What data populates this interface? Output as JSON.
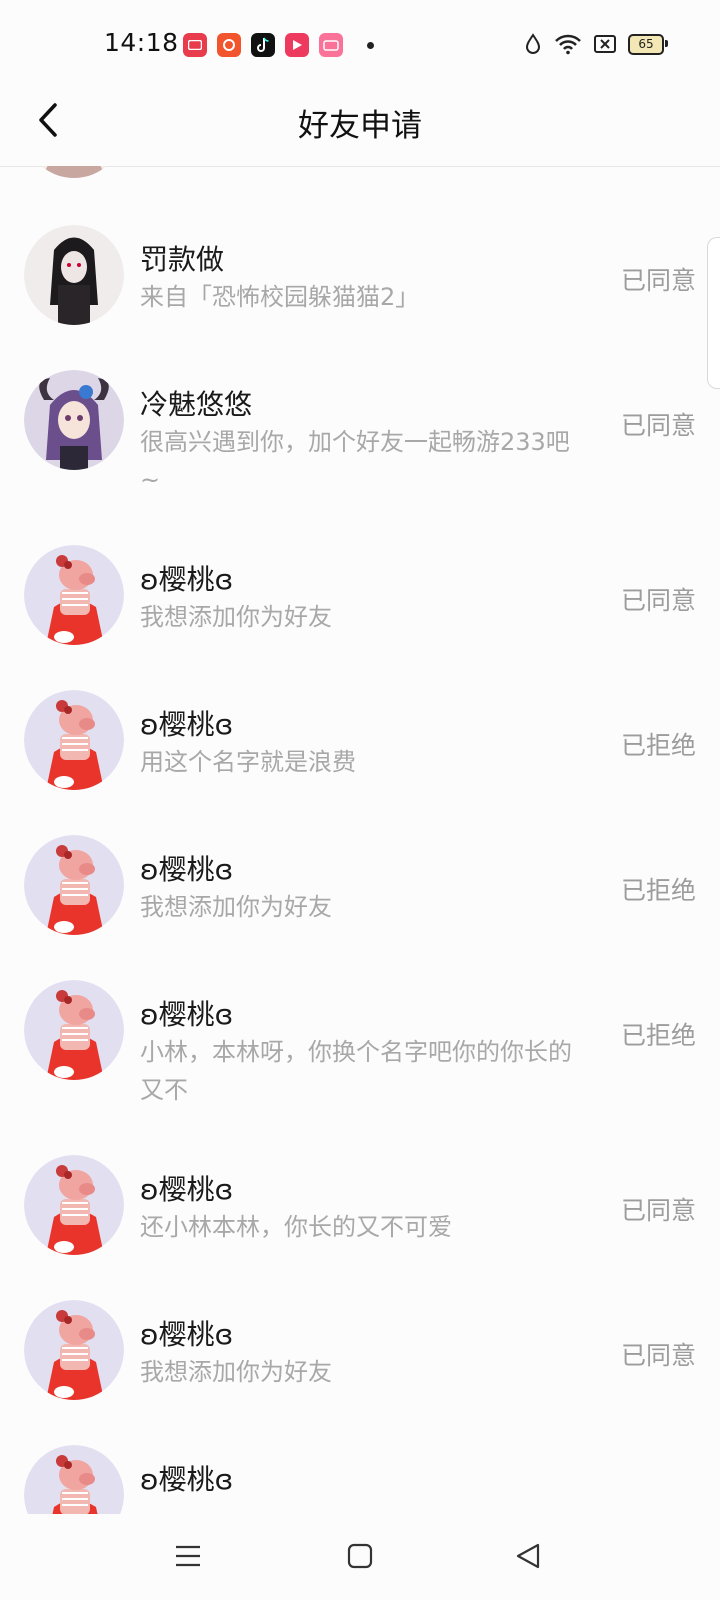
{
  "status_bar": {
    "time": "14:18",
    "battery": "65"
  },
  "header": {
    "title": "好友申请"
  },
  "requests": [
    {
      "name": "罚款做",
      "message": "来自「恐怖校园躲猫猫2」",
      "status": "已同意"
    },
    {
      "name": "冷魅悠悠",
      "message": "很高兴遇到你，加个好友一起畅游233吧~",
      "status": "已同意"
    },
    {
      "name": "ʚ樱桃ɞ",
      "message": "我想添加你为好友",
      "status": "已同意"
    },
    {
      "name": "ʚ樱桃ɞ",
      "message": "用这个名字就是浪费",
      "status": "已拒绝"
    },
    {
      "name": "ʚ樱桃ɞ",
      "message": "我想添加你为好友",
      "status": "已拒绝"
    },
    {
      "name": "ʚ樱桃ɞ",
      "message": "小林，本林呀，你换个名字吧你的你长的又不",
      "status": "已拒绝"
    },
    {
      "name": "ʚ樱桃ɞ",
      "message": "还小林本林，你长的又不可爱",
      "status": "已同意"
    },
    {
      "name": "ʚ樱桃ɞ",
      "message": "我想添加你为好友",
      "status": "已同意"
    },
    {
      "name": "ʚ樱桃ɞ"
    }
  ],
  "nav": {
    "icons": [
      "menu-icon",
      "home-icon",
      "back-triangle-icon"
    ]
  }
}
